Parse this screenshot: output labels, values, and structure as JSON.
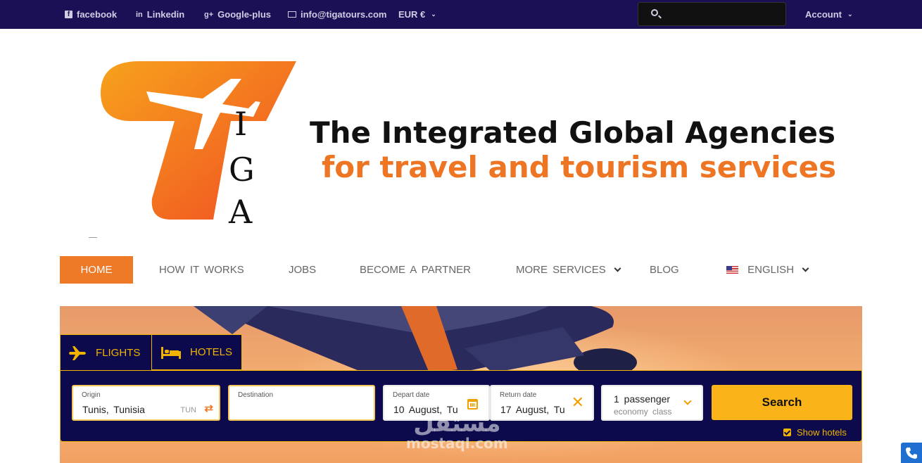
{
  "topbar": {
    "facebook": "facebook",
    "linkedin": "Linkedin",
    "googleplus": "Google-plus",
    "email": "info@tigatours.com",
    "currency": "EUR €",
    "account": "Account",
    "search_placeholder": ""
  },
  "header": {
    "logo_letters": [
      "I",
      "G",
      "A"
    ],
    "tagline_line1": "The Integrated Global Agencies",
    "tagline_line2": "for travel and tourism services"
  },
  "nav": {
    "items": [
      {
        "label": "HOME",
        "active": true
      },
      {
        "label": "HOW IT WORKS"
      },
      {
        "label": "JOBS"
      },
      {
        "label": "BECOME A PARTNER"
      },
      {
        "label": "MORE SERVICES",
        "dropdown": true
      },
      {
        "label": "BLOG"
      },
      {
        "label": "ENGLISH",
        "dropdown": true,
        "icon": "us-flag-icon"
      }
    ]
  },
  "booking": {
    "tabs": [
      {
        "label": "FLIGHTS",
        "icon": "airplane-icon",
        "active": true
      },
      {
        "label": "HOTELS",
        "icon": "bed-icon"
      }
    ],
    "origin": {
      "label": "Origin",
      "value": "Tunis, Tunisia",
      "code": "TUN"
    },
    "destination": {
      "label": "Destination",
      "value": ""
    },
    "depart": {
      "label": "Depart date",
      "value": "10 August, Tu"
    },
    "return": {
      "label": "Return date",
      "value": "17 August, Tu"
    },
    "passengers": {
      "line1": "1 passenger",
      "line2": "economy class"
    },
    "search_label": "Search",
    "show_hotels": "Show hotels"
  },
  "watermark": {
    "arabic": "مستقل",
    "latin": "mostaql.com"
  },
  "colors": {
    "brand_dark": "#1b1055",
    "accent_orange": "#ee7a27",
    "accent_yellow": "#fab41a",
    "form_bg": "#0c0a4d"
  }
}
